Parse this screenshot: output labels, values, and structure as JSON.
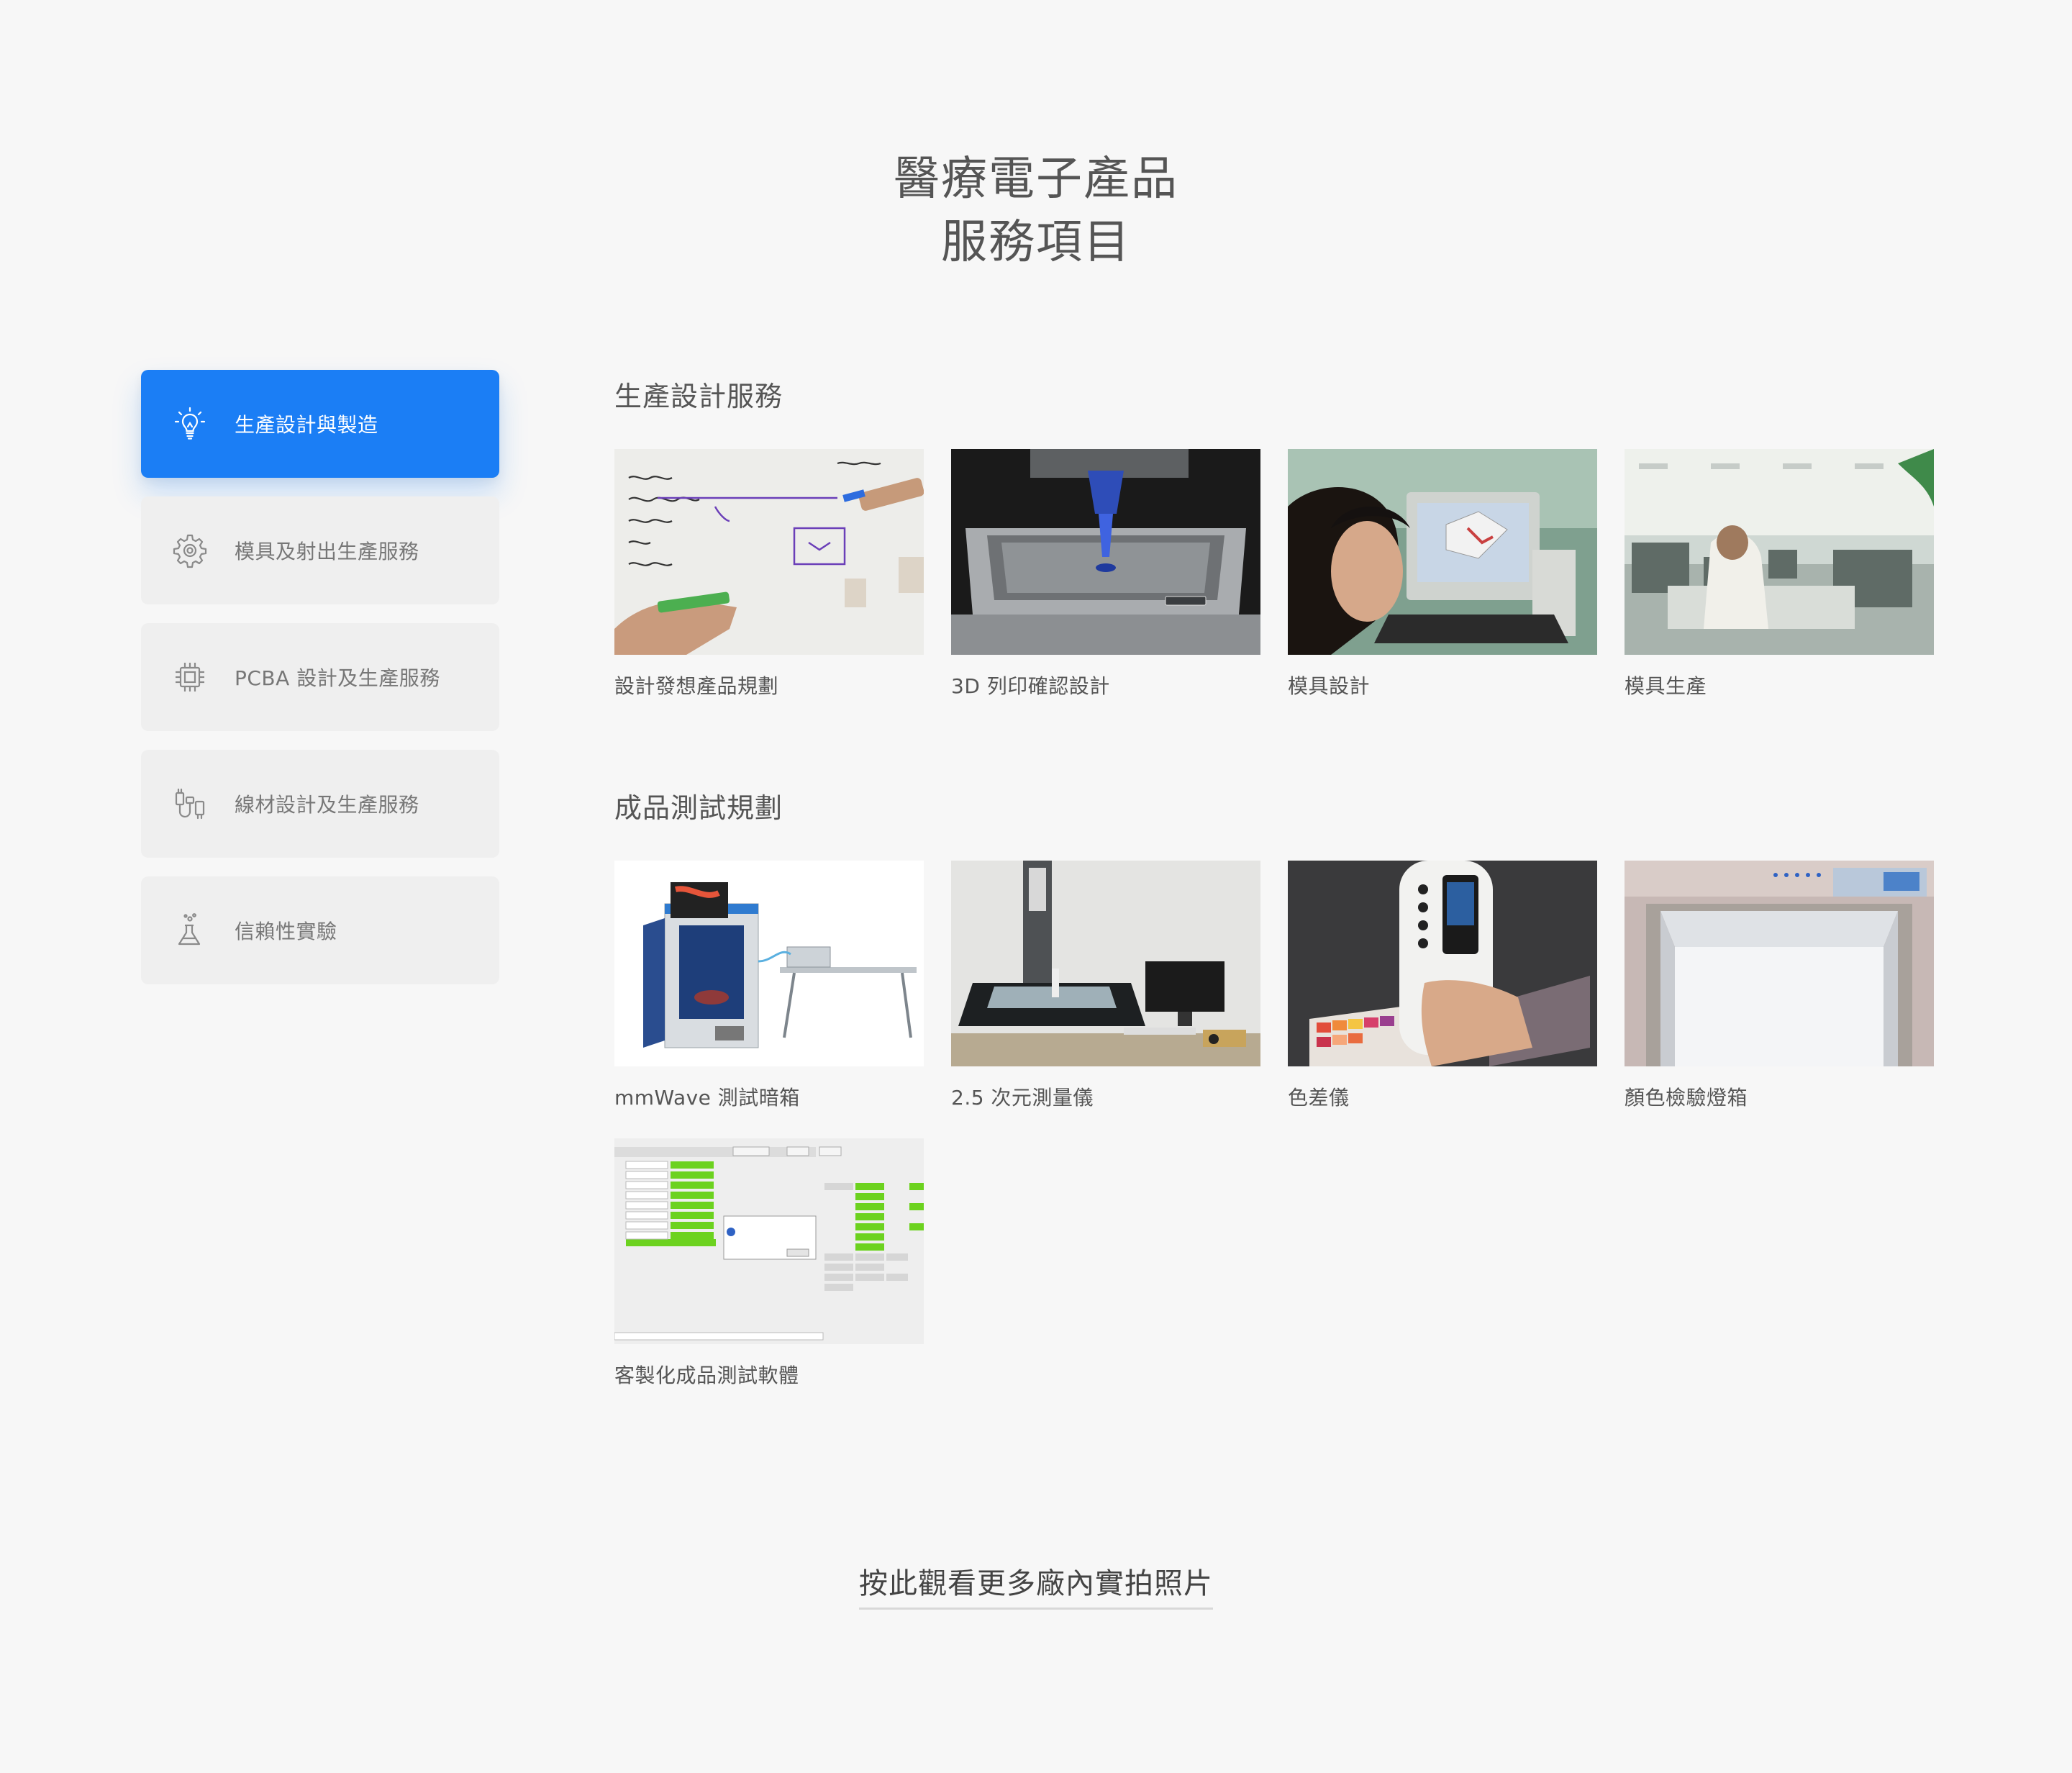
{
  "heading": {
    "line1": "醫療電子產品",
    "line2": "服務項目"
  },
  "sidebar": {
    "items": [
      {
        "label": "生產設計與製造",
        "icon": "lightbulb-icon",
        "active": true
      },
      {
        "label": "模具及射出生產服務",
        "icon": "gear-icon",
        "active": false
      },
      {
        "label": "PCBA 設計及生產服務",
        "icon": "chip-icon",
        "active": false
      },
      {
        "label": "線材設計及生產服務",
        "icon": "cable-icon",
        "active": false
      },
      {
        "label": "信賴性實驗",
        "icon": "flask-icon",
        "active": false
      }
    ]
  },
  "sections": [
    {
      "title": "生產設計服務",
      "cards": [
        {
          "caption": "設計發想產品規劃"
        },
        {
          "caption": "3D 列印確認設計"
        },
        {
          "caption": "模具設計"
        },
        {
          "caption": "模具生產"
        }
      ]
    },
    {
      "title": "成品測試規劃",
      "cards": [
        {
          "caption": "mmWave 測試暗箱"
        },
        {
          "caption": "2.5 次元測量儀"
        },
        {
          "caption": "色差儀"
        },
        {
          "caption": "顏色檢驗燈箱"
        },
        {
          "caption": "客製化成品測試軟體"
        }
      ]
    }
  ],
  "footer": {
    "more_link": "按此觀看更多廠內實拍照片"
  },
  "colors": {
    "accent": "#1b7ef5",
    "background": "#f7f7f7",
    "inactive_item": "#efefef"
  }
}
